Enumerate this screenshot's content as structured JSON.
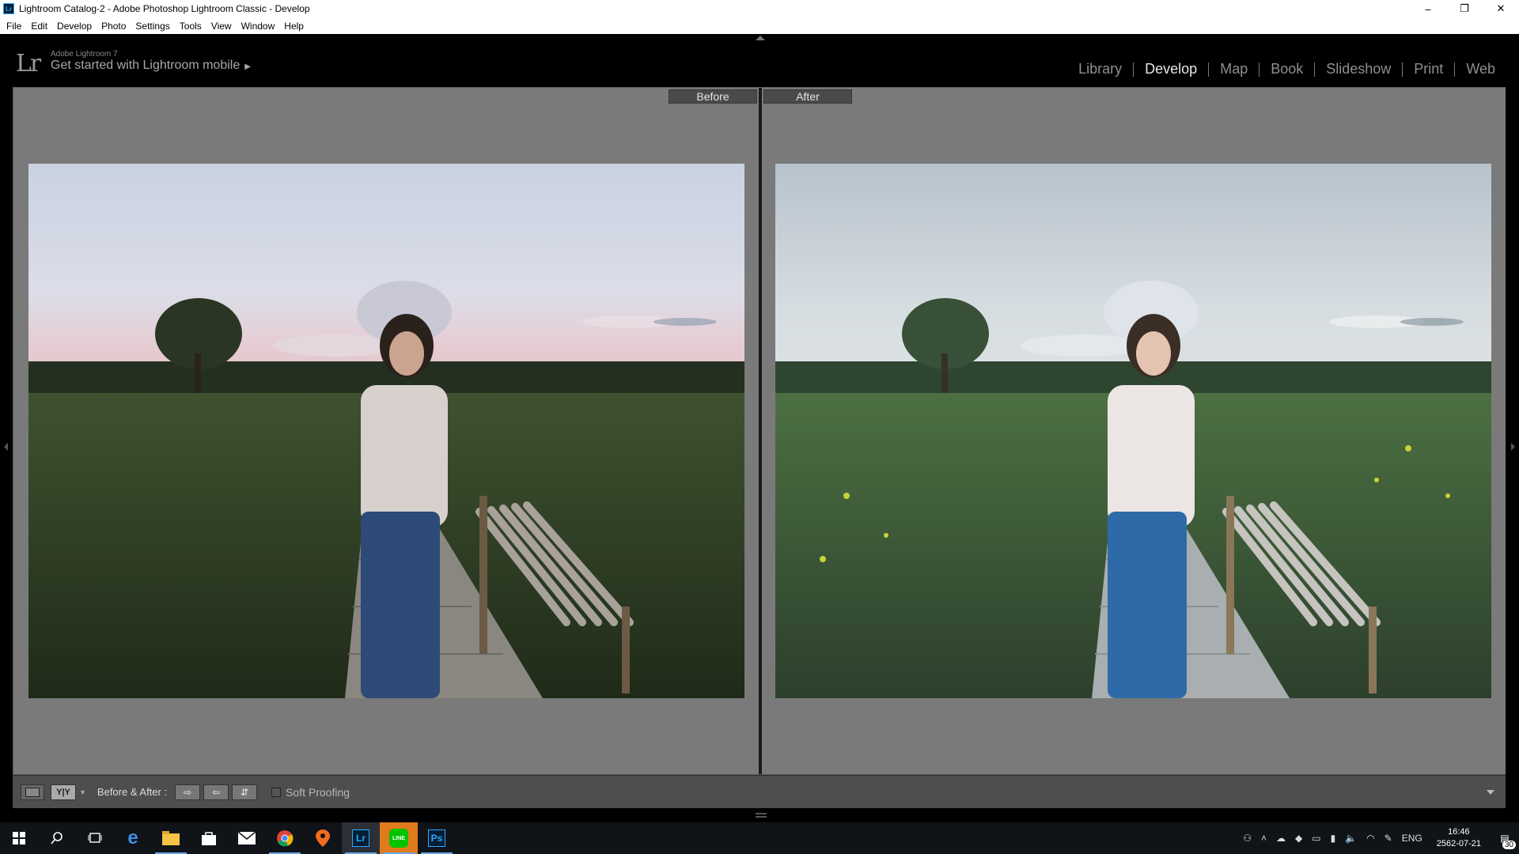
{
  "window": {
    "title": "Lightroom Catalog-2 - Adobe Photoshop Lightroom Classic - Develop",
    "app_badge": "Lr",
    "controls": [
      "–",
      "❐",
      "✕"
    ]
  },
  "menu": [
    "File",
    "Edit",
    "Develop",
    "Photo",
    "Settings",
    "Tools",
    "View",
    "Window",
    "Help"
  ],
  "identity": {
    "logo": "Lr",
    "product": "Adobe Lightroom 7",
    "mobile_prompt": "Get started with Lightroom mobile",
    "mobile_arrow": "▶"
  },
  "modules": [
    {
      "label": "Library",
      "active": false
    },
    {
      "label": "Develop",
      "active": true
    },
    {
      "label": "Map",
      "active": false
    },
    {
      "label": "Book",
      "active": false
    },
    {
      "label": "Slideshow",
      "active": false
    },
    {
      "label": "Print",
      "active": false
    },
    {
      "label": "Web",
      "active": false
    }
  ],
  "view": {
    "before_label": "Before",
    "after_label": "After"
  },
  "toolbar": {
    "yy_label": "Y|Y",
    "before_after_label": "Before & After :",
    "swap_right": "⇨",
    "swap_left": "⇦",
    "copy_settings": "⇵",
    "soft_proofing_label": "Soft Proofing",
    "soft_proofing_checked": false
  },
  "taskbar": {
    "apps": [
      "start-icon",
      "search-icon",
      "task-view-icon",
      "edge-icon",
      "file-explorer-icon",
      "store-icon",
      "mail-icon",
      "chrome-icon",
      "maps-icon",
      "lightroom-icon",
      "line-icon",
      "photoshop-icon"
    ],
    "lightroom_label": "Lr",
    "photoshop_label": "Ps",
    "line_label": "LINE",
    "language": "ENG",
    "time": "16:46",
    "date": "2562-07-21",
    "notification_count": "30"
  }
}
